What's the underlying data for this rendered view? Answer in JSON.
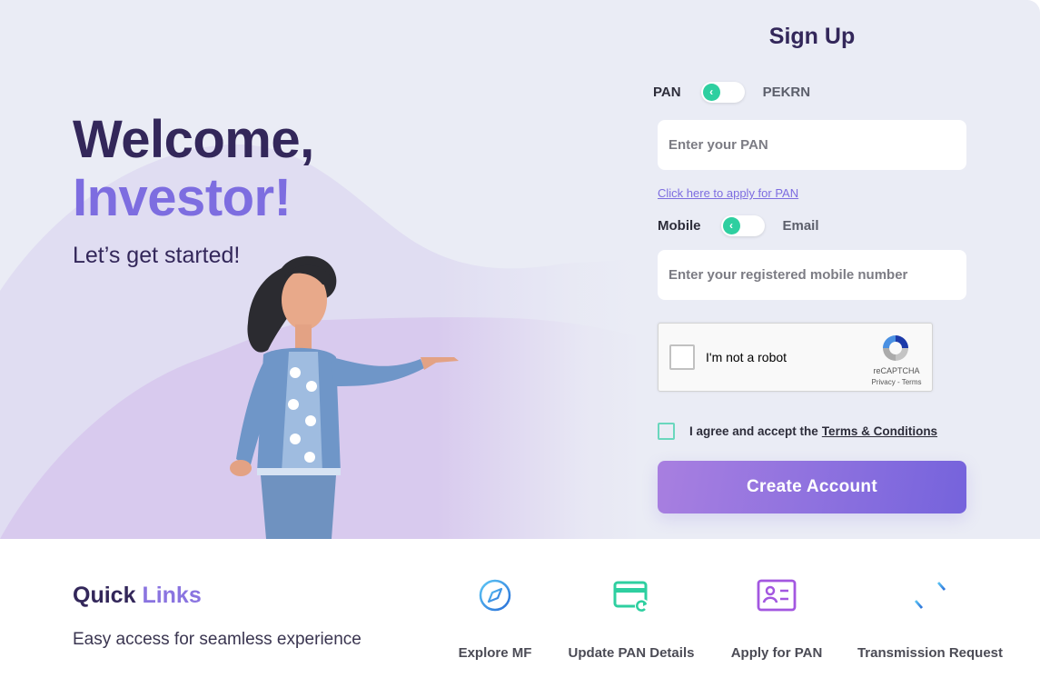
{
  "hero": {
    "welcome_line1": "Welcome,",
    "welcome_line2": "Investor!",
    "subtitle": "Let’s get started!"
  },
  "signup": {
    "title": "Sign Up",
    "id_toggle": {
      "left_label": "PAN",
      "right_label": "PEKRN",
      "selected": "PAN",
      "knob_glyph": "‹"
    },
    "pan_input": {
      "placeholder": "Enter your PAN",
      "value": ""
    },
    "apply_pan_link": "Click here to apply for PAN",
    "contact_toggle": {
      "left_label": "Mobile",
      "right_label": "Email",
      "selected": "Mobile",
      "knob_glyph": "‹"
    },
    "mobile_input": {
      "placeholder": "Enter your registered mobile number",
      "value": ""
    },
    "captcha": {
      "label": "I'm not a robot",
      "brand": "reCAPTCHA",
      "links": "Privacy - Terms",
      "checked": false
    },
    "agree": {
      "text": "I agree and accept the",
      "link": "Terms & Conditions",
      "checked": false
    },
    "create_button": "Create Account"
  },
  "quick_links": {
    "title_part1": "Quick",
    "title_part2": "Links",
    "subtitle": "Easy access for seamless experience",
    "items": [
      {
        "label": "Explore MF",
        "icon": "compass-icon"
      },
      {
        "label": "Update PAN Details",
        "icon": "card-refresh-icon"
      },
      {
        "label": "Apply for PAN",
        "icon": "id-card-icon"
      },
      {
        "label": "Transmission Request",
        "icon": "transfer-arrows-icon"
      }
    ]
  },
  "colors": {
    "primary_dark": "#33275a",
    "accent_purple": "#7d6de0",
    "toggle_green": "#2ecfa0",
    "hero_bg": "#eaecf5"
  }
}
